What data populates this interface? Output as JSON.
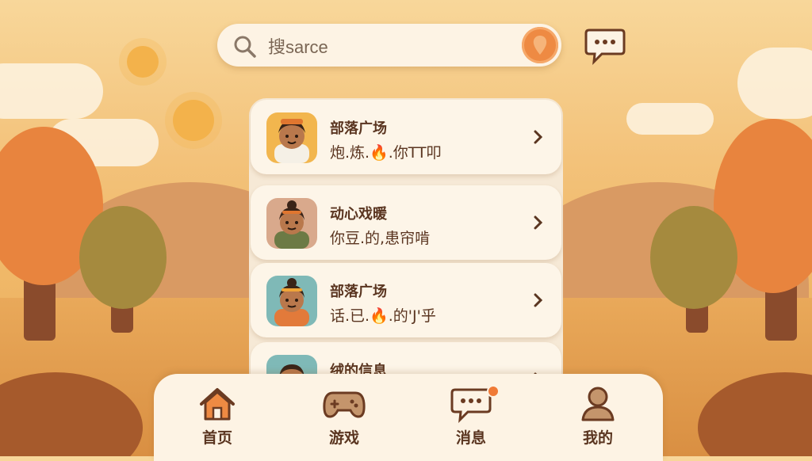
{
  "search": {
    "value": "搜sarce"
  },
  "list": {
    "items": [
      {
        "title": "部落广场",
        "subtitle": "炮.炼.🔥.你TT叩"
      },
      {
        "title": "动心戏暖",
        "subtitle": "你豆.的,患帘啃"
      },
      {
        "title": "部落广场",
        "subtitle": "话.已.🔥.的'J'乎"
      },
      {
        "title": "绒的信息",
        "subtitle": ""
      }
    ]
  },
  "tabs": [
    {
      "label": "首页",
      "icon": "home-icon"
    },
    {
      "label": "游戏",
      "icon": "gamepad-icon"
    },
    {
      "label": "消息",
      "icon": "message-icon"
    },
    {
      "label": "我的",
      "icon": "profile-icon"
    }
  ],
  "colors": {
    "accent": "#ee8a43",
    "text": "#5a3520",
    "card": "#fdf5e8"
  }
}
